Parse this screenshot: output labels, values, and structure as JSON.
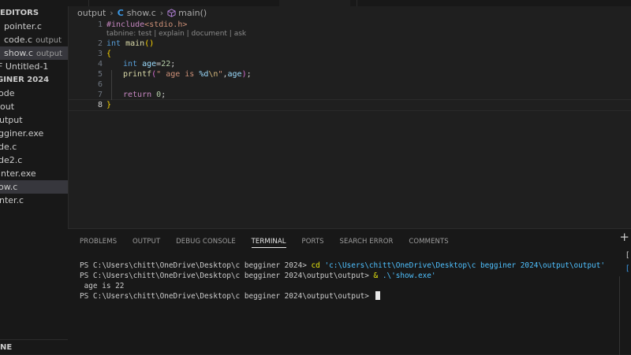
{
  "sidebar": {
    "open_editors_title": "EDITORS",
    "open_editors": [
      {
        "name": "pointer.c",
        "desc": ""
      },
      {
        "name": "code.c",
        "desc": "output"
      },
      {
        "name": "show.c",
        "desc": "output",
        "selected": true
      },
      {
        "name": "Untitled-1",
        "desc": "",
        "prefix": "F"
      }
    ],
    "folder_title": "GINER 2024",
    "folder_items": [
      {
        "name": "ode"
      },
      {
        "name": "out"
      },
      {
        "name": "utput"
      },
      {
        "name": "gginer.exe"
      },
      {
        "name": "de.c"
      },
      {
        "name": "de2.c"
      },
      {
        "name": "inter.exe"
      },
      {
        "name": "ow.c",
        "selected": true
      },
      {
        "name": "nter.c"
      }
    ],
    "outline_title": "NE"
  },
  "breadcrumb": {
    "folder": "output",
    "file": "show.c",
    "file_icon": "C",
    "symbol": "main()"
  },
  "codelens": "tabnine: test | explain | document | ask",
  "code": {
    "line_numbers": [
      "1",
      "2",
      "3",
      "4",
      "5",
      "6",
      "7",
      "8"
    ],
    "l1": {
      "directive": "#include",
      "header": "<stdio.h>"
    },
    "l2": {
      "type": "int",
      "name": "main",
      "parens": "()"
    },
    "l3": {
      "brace": "{"
    },
    "l4": {
      "type": "int",
      "rest_var": "age",
      "eq": "=",
      "num": "22",
      "semi": ";"
    },
    "l5": {
      "fn": "printf",
      "open": "(",
      "str_a": "\" age is ",
      "fmt": "%d",
      "esc": "\\n",
      "str_b": "\"",
      "comma": ",",
      "arg": "age",
      "close": ")",
      "semi": ";"
    },
    "l7": {
      "kw": "return",
      "num": "0",
      "semi": ";"
    },
    "l8": {
      "brace": "}"
    }
  },
  "panel": {
    "tabs": [
      "PROBLEMS",
      "OUTPUT",
      "DEBUG CONSOLE",
      "TERMINAL",
      "PORTS",
      "SEARCH ERROR",
      "COMMENTS"
    ],
    "active_tab": "TERMINAL",
    "plus": "+"
  },
  "terminal": {
    "line1_prompt": "PS C:\\Users\\chitt\\OneDrive\\Desktop\\c begginer 2024> ",
    "line1_cmd": "cd",
    "line1_arg": " 'c:\\Users\\chitt\\OneDrive\\Desktop\\c begginer 2024\\output\\output'",
    "line2_prompt": "PS C:\\Users\\chitt\\OneDrive\\Desktop\\c begginer 2024\\output\\output> ",
    "line2_cmd": "&",
    "line2_arg": " .\\'show.exe'",
    "line3_output": " age is 22",
    "line4_prompt": "PS C:\\Users\\chitt\\OneDrive\\Desktop\\c begginer 2024\\output\\output> "
  }
}
